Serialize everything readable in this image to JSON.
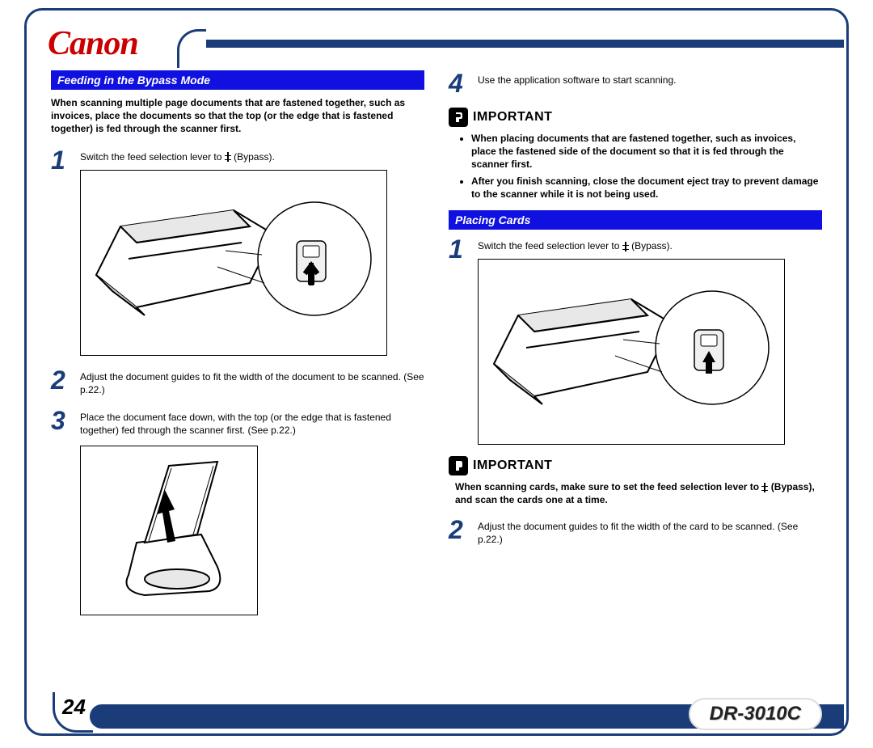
{
  "brand": "Canon",
  "model": "DR-3010C",
  "page_number": "24",
  "left": {
    "header": "Feeding in the Bypass Mode",
    "intro": "When scanning multiple page documents that are fastened together, such as invoices, place the documents so that the top (or the edge that is fastened together) is fed through the scanner first.",
    "step1_num": "1",
    "step1_text": "Switch the feed selection lever to ",
    "step1_suffix": " (Bypass).",
    "step2_num": "2",
    "step2_text": "Adjust the document guides to fit the width of the document to be scanned. (See p.22.)",
    "step3_num": "3",
    "step3_text": "Place the document face down, with the top (or the edge that is fastened together) fed through the scanner first. (See p.22.)"
  },
  "right": {
    "step4_num": "4",
    "step4_text": "Use the application software to start scanning.",
    "important1_label": "IMPORTANT",
    "important1_bullets": [
      "When placing documents that are fastened together, such as invoices,   place the fastened side of the document so that it is fed through the scanner first.",
      "After you finish scanning, close the document eject tray to prevent damage to the scanner while it is not being used."
    ],
    "header2": "Placing Cards",
    "pc_step1_num": "1",
    "pc_step1_text": "Switch the feed selection lever to ",
    "pc_step1_suffix": " (Bypass).",
    "important2_label": "IMPORTANT",
    "important2_text_a": "When scanning cards, make sure to set the feed selection lever to ",
    "important2_text_b": " (Bypass), and scan the cards one at a time.",
    "pc_step2_num": "2",
    "pc_step2_text": "Adjust the document guides to fit the width of the card to be scanned. (See p.22.)"
  }
}
